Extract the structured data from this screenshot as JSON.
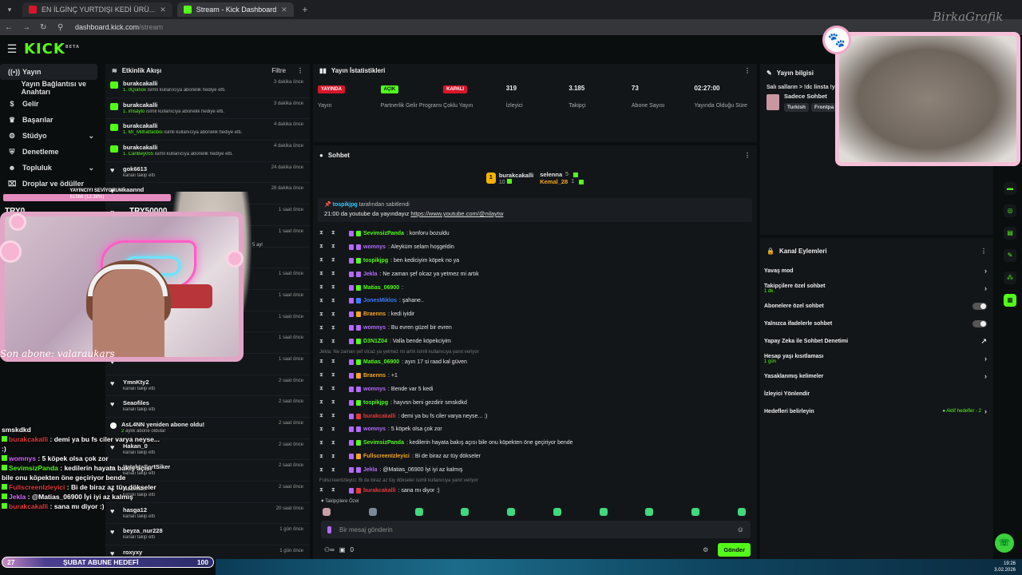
{
  "browser": {
    "tabs": [
      {
        "label": "EN İLGİNÇ YURTDIŞI KEDİ ÜRÜ...",
        "fav": "#d9152b",
        "active": false
      },
      {
        "label": "Stream - Kick Dashboard",
        "fav": "#53fc18",
        "active": true
      }
    ],
    "url_host": "dashboard.kick.com",
    "url_path": "/stream"
  },
  "brand": {
    "logo": "KICK",
    "logo_sup": "BETA",
    "overlay_brand": "BirkaGrafik"
  },
  "nav": [
    {
      "label": "Yayın",
      "icon": "broadcast-icon",
      "glyph": "((•))",
      "active": true
    },
    {
      "label": "Yayın Bağlantısı ve Anahtarı",
      "icon": "key-icon",
      "glyph": "",
      "active": false
    },
    {
      "label": "Gelir",
      "icon": "dollar-icon",
      "glyph": "$",
      "active": false
    },
    {
      "label": "Başarılar",
      "icon": "trophy-icon",
      "glyph": "♛",
      "active": false
    },
    {
      "label": "Stüdyo",
      "icon": "studio-icon",
      "glyph": "⚙",
      "active": false,
      "chev": "⌄"
    },
    {
      "label": "Denetleme",
      "icon": "shield-icon",
      "glyph": "⛨",
      "active": false
    },
    {
      "label": "Topluluk",
      "icon": "community-icon",
      "glyph": "☻",
      "active": false,
      "chev": "⌄"
    },
    {
      "label": "Droplar ve ödüller",
      "icon": "gift-icon",
      "glyph": "⌧",
      "active": false
    }
  ],
  "activity": {
    "title": "Etkinlik Akışı",
    "filter": "Filtre",
    "rows": [
      {
        "name": "burakcakalli",
        "hl": "1. 0Quinox",
        "sub": " isimli kullanıcıya abonelik hediye etti.",
        "time": "3 dakika önce",
        "icon": "gift"
      },
      {
        "name": "burakcakalli",
        "hl": "1. imsayto",
        "sub": " isimli kullanıcıya abonelik hediye etti.",
        "time": "3 dakika önce",
        "icon": "gift"
      },
      {
        "name": "burakcakalli",
        "hl": "1. Mr_Mithatfanboi",
        "sub": " isimli kullanıcıya abonelik hediye etti.",
        "time": "4 dakika önce",
        "icon": "gift"
      },
      {
        "name": "burakcakalli",
        "hl": "1. CanBey055",
        "sub": " isimli kullanıcıya abonelik hediye etti.",
        "time": "4 dakika önce",
        "icon": "gift"
      },
      {
        "name": "gok6613",
        "hl": "",
        "sub": "kanalı takip etti",
        "time": "24 dakika önce",
        "icon": "heart"
      },
      {
        "name": "kaannd",
        "hl": "",
        "sub": "",
        "time": "28 dakika önce",
        "icon": "heart"
      },
      {
        "name": "",
        "hl": "",
        "sub": "",
        "time": "1 saat önce",
        "icon": "heart"
      },
      {
        "name": "",
        "hl": "",
        "sub": "",
        "time": "1 saat önce",
        "icon": "heart"
      },
      {
        "name": "",
        "hl": "",
        "sub": "",
        "time": "",
        "icon": "heart"
      },
      {
        "name": "",
        "hl": "",
        "sub": "",
        "time": "1 saat önce",
        "icon": "heart"
      },
      {
        "name": "",
        "hl": "",
        "sub": "",
        "time": "1 saat önce",
        "icon": "heart"
      },
      {
        "name": "",
        "hl": "",
        "sub": "",
        "time": "1 saat önce",
        "icon": "heart"
      },
      {
        "name": "",
        "hl": "",
        "sub": "",
        "time": "1 saat önce",
        "icon": "heart"
      },
      {
        "name": "",
        "hl": "",
        "sub": "",
        "time": "1 saat önce",
        "icon": "heart"
      },
      {
        "name": "YmnKty2",
        "hl": "",
        "sub": "kanalı takip etti",
        "time": "2 saat önce",
        "icon": "heart"
      },
      {
        "name": "Seaofiles",
        "hl": "",
        "sub": "kanalı takip etti",
        "time": "2 saat önce",
        "icon": "heart"
      },
      {
        "name": "AsL4NN yeniden abone oldu!",
        "hl": "2",
        "sub": " aylık abone oldular",
        "time": "2 saat önce",
        "icon": "star"
      },
      {
        "name": "Hakan_0",
        "hl": "",
        "sub": "kanalı takip etti",
        "time": "2 saat önce",
        "icon": "heart"
      },
      {
        "name": "YataktaŞertSiker",
        "hl": "",
        "sub": "kanalı takip etti",
        "time": "2 saat önce",
        "icon": "heart"
      },
      {
        "name": "Hazman",
        "hl": "",
        "sub": "kanalı takip etti",
        "time": "2 saat önce",
        "icon": "heart"
      },
      {
        "name": "hasga12",
        "hl": "",
        "sub": "kanalı takip etti",
        "time": "20 saat önce",
        "icon": "heart"
      },
      {
        "name": "beyza_nur228",
        "hl": "",
        "sub": "kanalı takip etti",
        "time": "1 gün önce",
        "icon": "heart"
      },
      {
        "name": "roxyxy",
        "hl": "",
        "sub": "",
        "time": "1 gün önce",
        "icon": "heart"
      }
    ]
  },
  "stats": {
    "title": "Yayın İstatistikleri",
    "items": [
      {
        "pill": "YAYINDA",
        "pill_color": "red",
        "num": "",
        "label": "Yayın"
      },
      {
        "pill": "AÇIK",
        "pill_color": "green",
        "num": "",
        "label": "Partnerlik Gelir Programı"
      },
      {
        "pill": "KAPALI",
        "pill_color": "red",
        "num": "",
        "label": "Çoklu Yayın"
      },
      {
        "pill": "",
        "pill_color": "",
        "num": "319",
        "label": "İzleyici"
      },
      {
        "pill": "",
        "pill_color": "",
        "num": "3.185",
        "label": "Takipçi"
      },
      {
        "pill": "",
        "pill_color": "",
        "num": "73",
        "label": "Abone Sayısı"
      },
      {
        "pill": "",
        "pill_color": "",
        "num": "02:27:00",
        "label": "Yayında Olduğu Süre"
      }
    ]
  },
  "chat": {
    "title": "Sohbet",
    "gifters": [
      {
        "name": "burakcakalli",
        "count": "10"
      },
      {
        "name": "selenna",
        "count": "5"
      },
      {
        "name": "Kemal_28",
        "count": "1"
      }
    ],
    "pinned_by": "tospikjpg",
    "pinned_label": " tarafından sabitlendi",
    "pinned_text": "21:00 da youtube da yayındayız ",
    "pinned_link": "https://www.youtube.com/@nilaytw",
    "messages": [
      {
        "user": "SevimsizPanda",
        "color": "#53fc18",
        "text": ": konforu bozuldu",
        "sys": false
      },
      {
        "user": "womnys",
        "color": "#b26bf8",
        "text": ": Aleyküm selam hoşgeldin",
        "sys": false
      },
      {
        "user": "tospikjpg",
        "color": "#53fc18",
        "text": ": ben kediciyim köpek no ya",
        "sys": false
      },
      {
        "user": "Jekla",
        "color": "#b26bf8",
        "text": ": Ne zaman şef olcaz ya yetmez mi artık",
        "sys": false
      },
      {
        "user": "Matias_06900",
        "color": "#53fc18",
        "text": ":",
        "sys": false
      },
      {
        "user": "JonesMiklos",
        "color": "#3c7cff",
        "text": ": şahane..",
        "sys": false
      },
      {
        "user": "Braenns",
        "color": "#f5a623",
        "text": ": kedi iyidir",
        "sys": false
      },
      {
        "user": "womnys",
        "color": "#b26bf8",
        "text": ": Bu evren güzel bir evren",
        "sys": false
      },
      {
        "user": "D3N1Z04",
        "color": "#53fc18",
        "text": ": Valla bende köpekciyim",
        "sys": false
      },
      {
        "user": "",
        "color": "",
        "text": "Jekla: Ne zaman şef olcaz ya yetmez mi artık isimli kullanıcıya yanıt veriyor",
        "sys": true
      },
      {
        "user": "Matias_06900",
        "color": "#53fc18",
        "text": ": ayın 17 si raad kal güven",
        "sys": false
      },
      {
        "user": "Braenns",
        "color": "#f5a623",
        "text": ": +1",
        "sys": false
      },
      {
        "user": "womnys",
        "color": "#b26bf8",
        "text": ": Bende var 5 kedi",
        "sys": false
      },
      {
        "user": "tospikjpg",
        "color": "#53fc18",
        "text": ": hayvsn beni gezdirir smskdkd",
        "sys": false
      },
      {
        "user": "burakcakalli",
        "color": "#e03b3b",
        "text": ": demi ya bu fs ciler varya neyse... :)",
        "sys": false
      },
      {
        "user": "womnys",
        "color": "#b26bf8",
        "text": ": 5 köpek olsa çok zor",
        "sys": false
      },
      {
        "user": "SevimsizPanda",
        "color": "#53fc18",
        "text": ": kedilerin hayata bakış açısı bile onu köpekten öne geçiriyor bende",
        "sys": false
      },
      {
        "user": "FullscreenIzleyici",
        "color": "#f5a623",
        "text": ": Bi de biraz az tüy dökseler",
        "sys": false
      },
      {
        "user": "Jekla",
        "color": "#b26bf8",
        "text": ": @Matias_06900 İyi iyi az kalmış",
        "sys": false
      },
      {
        "user": "",
        "color": "",
        "text": "FullscreenIzleyici: Bi de biraz az tüy dökseler isimli kullanıcıya yanıt veriyor",
        "sys": true
      },
      {
        "user": "burakcakalli",
        "color": "#e03b3b",
        "text": ": sana mı diyor :)",
        "sys": false
      }
    ],
    "followers_only": "♥ Takipçilere Özel",
    "input_placeholder": "Bir mesaj gönderin",
    "points": "0",
    "send": "Gönder"
  },
  "stream_info": {
    "title": "Yayın bilgisi",
    "stream_title": "Salı salların > !dc linsta !y",
    "category": "Sadece Sohbet",
    "tags": [
      "Turkish",
      "Frontpa"
    ]
  },
  "channel_actions": {
    "title": "Kanal Eylemleri",
    "rows": [
      {
        "label": "Yavaş mod",
        "sub": "",
        "kind": "chev"
      },
      {
        "label": "Takipçilere özel sohbet",
        "sub": "1 dk.",
        "kind": "chev"
      },
      {
        "label": "Abonelere özel sohbet",
        "sub": "",
        "kind": "toggle"
      },
      {
        "label": "Yalnızca ifadelerle sohbet",
        "sub": "",
        "kind": "toggle"
      },
      {
        "label": "Yapay Zeka ile Sohbet Denetimi",
        "sub": "",
        "kind": "ext"
      },
      {
        "label": "Hesap yaşı kısıtlaması",
        "sub": "1 gün",
        "kind": "chev"
      },
      {
        "label": "Yasaklanmış kelimeler",
        "sub": "",
        "kind": "chev"
      },
      {
        "label": "İzleyici Yönlendir",
        "sub": "",
        "kind": "none"
      },
      {
        "label": "Hedefleri belirleyin",
        "sub": "",
        "kind": "goals",
        "side": "● Aktif hedefler - 2"
      }
    ]
  },
  "overlay": {
    "sub_title": "YAYINCIYI SEVİYORUM",
    "sub_bar": "61566 (12.38%)",
    "left_amount": "TRY0",
    "right_amount": "TRY50000",
    "caption": "Son abone: valaraukars",
    "follow_age": "5 ayl",
    "chat_lines": [
      {
        "user": "",
        "text": "smskdkd",
        "cls": ""
      },
      {
        "user": "burakcakalli",
        "text": " : demi ya bu fs ciler varya neyse... :)",
        "cls": "red"
      },
      {
        "user": "womnys",
        "text": " : 5 köpek olsa çok zor",
        "cls": "pk"
      },
      {
        "user": "SevimsizPanda",
        "text": " : kedilerin hayata bakış açısı bile onu köpekten öne geçiriyor bende",
        "cls": ""
      },
      {
        "user": "FullscreenIzleyici",
        "text": " : Bi de biraz az tüy dökseler",
        "cls": "red"
      },
      {
        "user": "Jekla",
        "text": " : @Matias_06900 İyi iyi az kalmış",
        "cls": "pk"
      },
      {
        "user": "burakcakalli",
        "text": " : sana mı diyor :)",
        "cls": "red"
      }
    ],
    "goal_left": "27",
    "goal_label": "ŞUBAT ABUNE HEDEFİ",
    "goal_right": "100"
  },
  "clock": {
    "time": "19:26",
    "date": "3.02.2026"
  }
}
